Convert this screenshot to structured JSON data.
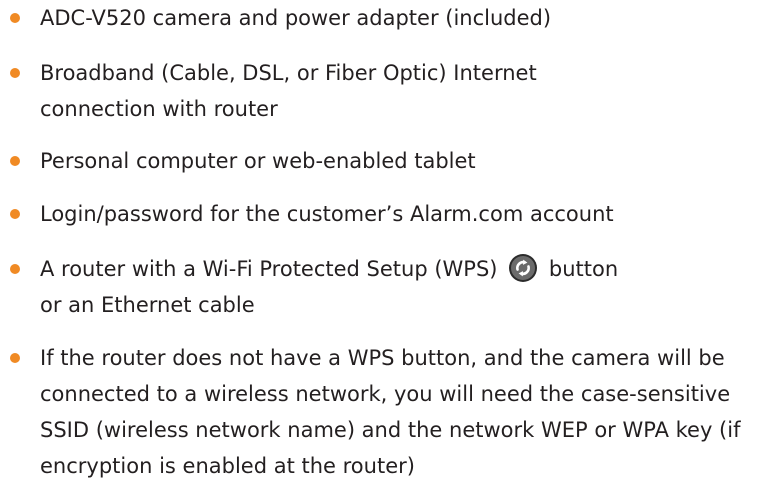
{
  "colors": {
    "bullet": "#f08a24",
    "text": "#231f20",
    "icon_fill": "#6b6b6b"
  },
  "items": [
    {
      "lines": [
        "ADC-V520 camera and power adapter (included)"
      ]
    },
    {
      "lines": [
        "Broadband (Cable, DSL, or Fiber Optic) Internet",
        "connection with router"
      ]
    },
    {
      "lines": [
        "Personal computer or web-enabled tablet"
      ]
    },
    {
      "lines": [
        "Login/password for the customer’s Alarm.com account"
      ]
    },
    {
      "line1_before_icon": "A router with a Wi-Fi Protected Setup (WPS)",
      "line1_after_icon": "button",
      "icon": "wps-icon",
      "lines": [
        "or an Ethernet cable"
      ]
    },
    {
      "lines": [
        "If the router does not have a WPS button, and the camera will be",
        "connected to a wireless network, you will need the case-sensitive",
        "SSID (wireless network name) and the network WEP or WPA key (if",
        "encryption is enabled at the router)"
      ]
    }
  ]
}
